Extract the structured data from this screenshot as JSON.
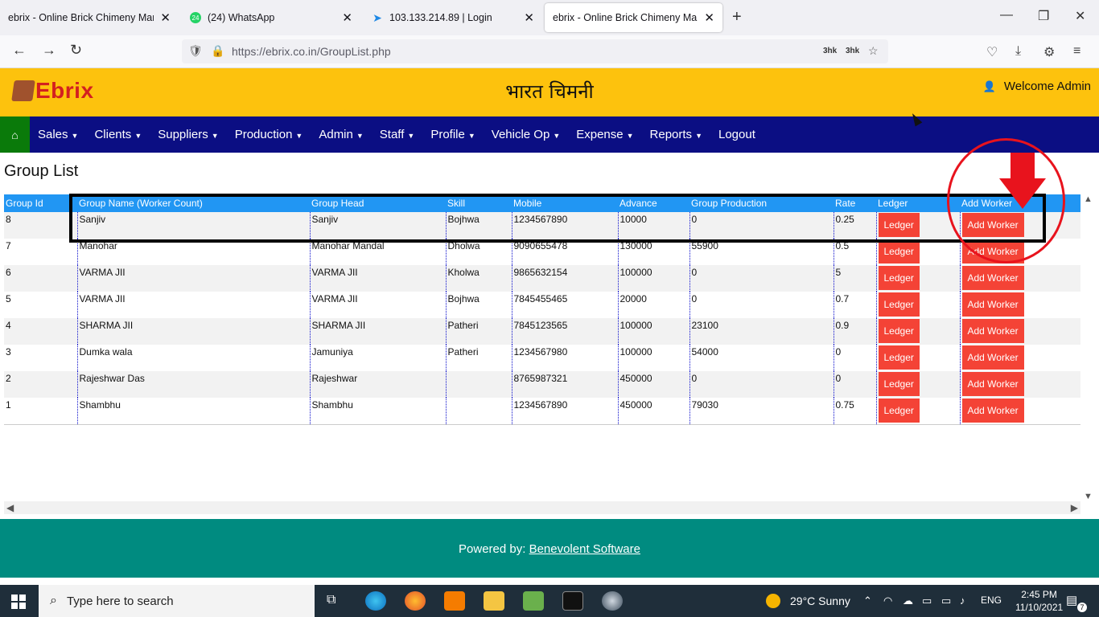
{
  "browser": {
    "tabs": [
      {
        "title": "ebrix - Online Brick Chimeny Manag",
        "active": false
      },
      {
        "title": "(24) WhatsApp",
        "active": false
      },
      {
        "title": "103.133.214.89 | Login",
        "active": false
      },
      {
        "title": "ebrix - Online Brick Chimeny Manag",
        "active": true
      }
    ],
    "url": "https://ebrix.co.in/GroupList.php",
    "zoom_a": "3hk",
    "zoom_b": "3hk",
    "whatsapp_badge": "24"
  },
  "header": {
    "logo_text": "Ebrix",
    "site_name": "भारत चिमनी",
    "welcome": "Welcome Admin"
  },
  "menu": {
    "items": [
      "Sales",
      "Clients",
      "Suppliers",
      "Production",
      "Admin",
      "Staff",
      "Profile",
      "Vehicle Op",
      "Expense",
      "Reports"
    ],
    "logout": "Logout"
  },
  "page": {
    "title": "Group List"
  },
  "table": {
    "headers": [
      "Group Id",
      "Group Name (Worker Count)",
      "Group Head",
      "Skill",
      "Mobile",
      "Advance",
      "Group Production",
      "Rate",
      "Ledger",
      "Add Worker"
    ],
    "rows": [
      {
        "id": "8",
        "name": "Sanjiv",
        "head": "Sanjiv",
        "skill": "Bojhwa",
        "mobile": "1234567890",
        "advance": "10000",
        "production": "0",
        "rate": "0.25",
        "ledger": "Ledger",
        "add": "Add Worker"
      },
      {
        "id": "7",
        "name": "Manohar",
        "head": "Manohar Mandal",
        "skill": "Dholwa",
        "mobile": "9090655478",
        "advance": "130000",
        "production": "55900",
        "rate": "0.5",
        "ledger": "Ledger",
        "add": "Add Worker"
      },
      {
        "id": "6",
        "name": "VARMA JII",
        "head": "VARMA JII",
        "skill": "Kholwa",
        "mobile": "9865632154",
        "advance": "100000",
        "production": "0",
        "rate": "5",
        "ledger": "Ledger",
        "add": "Add Worker"
      },
      {
        "id": "5",
        "name": "VARMA JII",
        "head": "VARMA JII",
        "skill": "Bojhwa",
        "mobile": "7845455465",
        "advance": "20000",
        "production": "0",
        "rate": "0.7",
        "ledger": "Ledger",
        "add": "Add Worker"
      },
      {
        "id": "4",
        "name": "SHARMA JII",
        "head": "SHARMA JII",
        "skill": "Patheri",
        "mobile": "7845123565",
        "advance": "100000",
        "production": "23100",
        "rate": "0.9",
        "ledger": "Ledger",
        "add": "Add Worker"
      },
      {
        "id": "3",
        "name": "Dumka wala",
        "head": "Jamuniya",
        "skill": "Patheri",
        "mobile": "1234567980",
        "advance": "100000",
        "production": "54000",
        "rate": "0",
        "ledger": "Ledger",
        "add": "Add Worker"
      },
      {
        "id": "2",
        "name": "Rajeshwar Das",
        "head": "Rajeshwar",
        "skill": "",
        "mobile": "8765987321",
        "advance": "450000",
        "production": "0",
        "rate": "0",
        "ledger": "Ledger",
        "add": "Add Worker"
      },
      {
        "id": "1",
        "name": "Shambhu",
        "head": "Shambhu",
        "skill": "",
        "mobile": "1234567890",
        "advance": "450000",
        "production": "79030",
        "rate": "0.75",
        "ledger": "Ledger",
        "add": "Add Worker"
      }
    ]
  },
  "footer": {
    "prefix": "Powered by: ",
    "link": "Benevolent Software"
  },
  "taskbar": {
    "search_placeholder": "Type here to search",
    "weather": "29°C  Sunny",
    "lang": "ENG",
    "time": "2:45 PM",
    "date": "11/10/2021",
    "notifications": "7"
  },
  "colors": {
    "header_bg": "#fdc20d",
    "menu_bg": "#0b0e83",
    "home_bg": "#0a7a0a",
    "table_header": "#2196f3",
    "button": "#f44336",
    "footer_bg": "#008b80",
    "annotation_red": "#e8131d"
  }
}
